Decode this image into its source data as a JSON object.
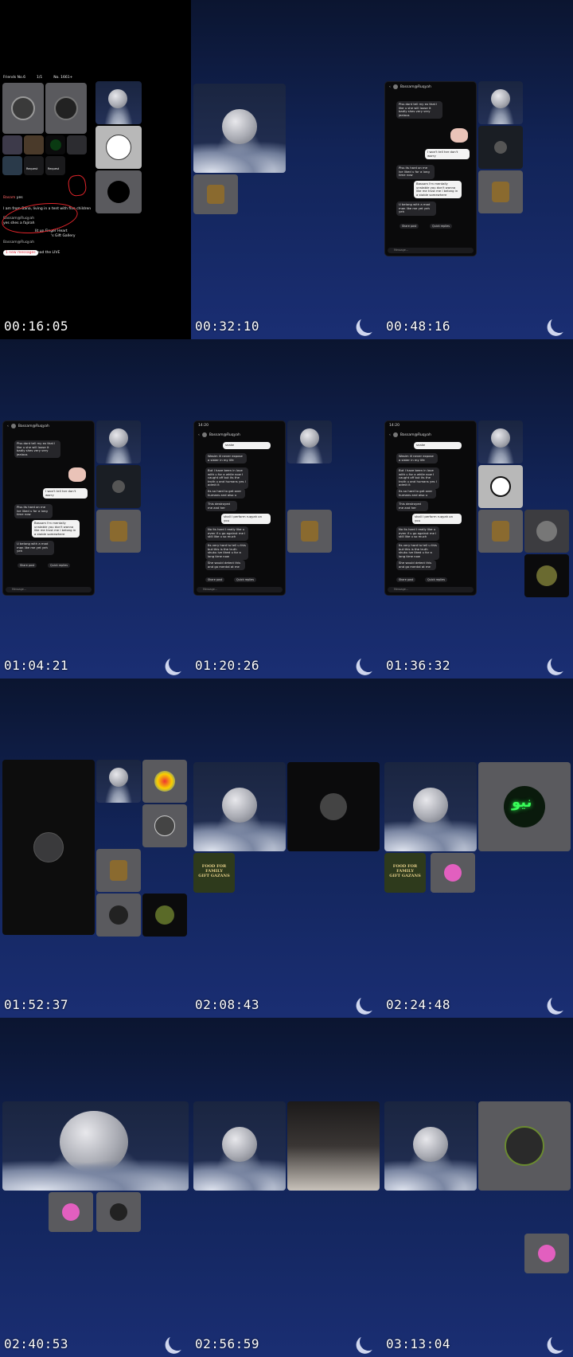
{
  "frames": [
    {
      "timestamp": "00:16:05"
    },
    {
      "timestamp": "00:32:10"
    },
    {
      "timestamp": "00:48:16"
    },
    {
      "timestamp": "01:04:21"
    },
    {
      "timestamp": "01:20:26"
    },
    {
      "timestamp": "01:36:32"
    },
    {
      "timestamp": "01:52:37"
    },
    {
      "timestamp": "02:08:43"
    },
    {
      "timestamp": "02:24:48"
    },
    {
      "timestamp": "02:40:53"
    },
    {
      "timestamp": "02:56:59"
    },
    {
      "timestamp": "03:13:04"
    }
  ],
  "frame1": {
    "topbar": [
      "Friends No.6",
      "1/1",
      "No. 1661+"
    ],
    "grid_labels": [
      "Request",
      "Request"
    ],
    "chat": [
      {
        "user": "Basam",
        "text": "yes"
      },
      {
        "user": "",
        "text": "I am from Bana, living in a tent with five children"
      },
      {
        "user": "Bassam@Ruqyah",
        "text": "yes shes a fajirah"
      },
      {
        "user": "",
        "text": "lit up Finger Heart"
      },
      {
        "user": "",
        "text": "'s Gift Gallery"
      },
      {
        "user": "Bassam@Ruqyah",
        "text": ""
      }
    ],
    "new_messages": "1 new messages",
    "read_live": "Read the LIVE"
  },
  "chat_a": {
    "header": "Bassam@Ruqyah",
    "messages": [
      {
        "dir": "in",
        "text": "Plss dont tell my ex that I like u she will loose it badly shes very very jealous"
      },
      {
        "dir": "out",
        "text": "I won't tell her don't worry"
      },
      {
        "dir": "in",
        "text": "Plss its hard on me lve liked u for a long time now"
      },
      {
        "dir": "out",
        "text": "Bassam I'm mentally unstable you don't wanna like me trust me I belong in a stable somewhere"
      },
      {
        "dir": "in",
        "text": "U belong with a mad man like me yet yeh yeh"
      }
    ],
    "chips": [
      "Share post",
      "Quick replies"
    ],
    "input_placeholder": "Message..."
  },
  "chat_b": {
    "status_time": "14:20",
    "header": "Bassam@Ruqyah",
    "messages": [
      {
        "dir": "out",
        "text": "snake"
      },
      {
        "dir": "in",
        "text": "Wasim ill never expose a sister in my life"
      },
      {
        "dir": "in",
        "text": "But I have been in love with u for a while now I caught off but its the truth u and humans yes I admit it"
      },
      {
        "dir": "in",
        "text": "Its so hard to get over humans and also u"
      },
      {
        "dir": "in",
        "text": "This destroyed me and her"
      },
      {
        "dir": "out",
        "text": "shall I perform ruqyah on you"
      },
      {
        "dir": "in",
        "text": "No its hard I really like u even if u go against me I still like u so much"
      },
      {
        "dir": "in",
        "text": "Its very hard to tell u this but this is the truth shuku ive liked u for a long time now"
      },
      {
        "dir": "in",
        "text": "She would detect this and go mental at me"
      }
    ],
    "chips": [
      "Share post",
      "Quick replies"
    ],
    "input_placeholder": "Message..."
  },
  "food_tile": {
    "title": "FOOD FOR FAMILY",
    "subtitle": "GIFT GAZANS"
  },
  "neon_text": "نيو"
}
